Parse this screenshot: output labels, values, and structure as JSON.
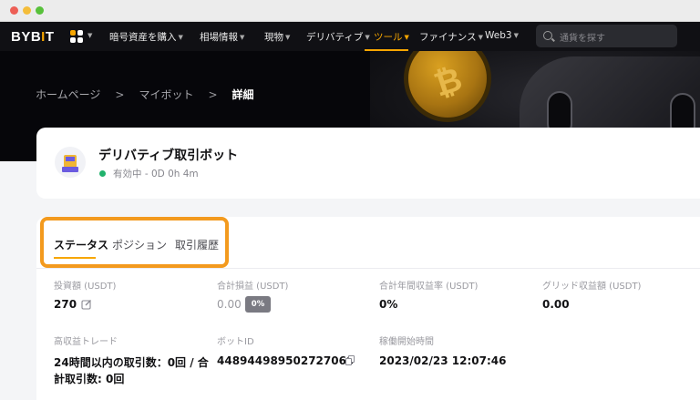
{
  "nav": {
    "logo_main": "BYB",
    "logo_mark": "I",
    "logo_end": "T",
    "items": [
      {
        "label": "暗号資産を購入"
      },
      {
        "label": "相場情報"
      },
      {
        "label": "現物"
      },
      {
        "label": "デリバティブ"
      },
      {
        "label": "ツール"
      },
      {
        "label": "ファイナンス"
      },
      {
        "label": "Web3"
      }
    ],
    "active_item": "ツール",
    "search_placeholder": "通貨を探す",
    "accent_color": "#f7a600"
  },
  "breadcrumb": {
    "home": "ホームページ",
    "mybot": "マイボット",
    "current": "詳細"
  },
  "bot": {
    "title": "デリバティブ取引ボット",
    "status": "有効中 - 0D 0h 4m",
    "status_color": "#20b26c"
  },
  "tabs": [
    {
      "label": "ステータス"
    },
    {
      "label": "ポジション"
    },
    {
      "label": "取引履歴"
    }
  ],
  "active_tab": "ステータス",
  "stats": {
    "investment_label": "投資額 (USDT)",
    "investment_value": "270",
    "total_pnl_label": "合計損益 (USDT)",
    "total_pnl_value": "0.00",
    "total_pnl_badge": "0%",
    "annual_yield_label": "合計年間収益率 (USDT)",
    "annual_yield_value": "0%",
    "grid_profit_label": "グリッド収益額 (USDT)",
    "grid_profit_value": "0.00",
    "high_trades_label": "高収益トレード",
    "high_trades_line1": "24時間以内の取引数：0回 / 合",
    "high_trades_line2": "計取引数: 0回",
    "bot_id_label": "ボットID",
    "bot_id_value": "448944989502727060",
    "start_time_label": "稼働開始時間",
    "start_time_value": "2023/02/23 12:07:46"
  },
  "highlight_color": "#f39a1e"
}
